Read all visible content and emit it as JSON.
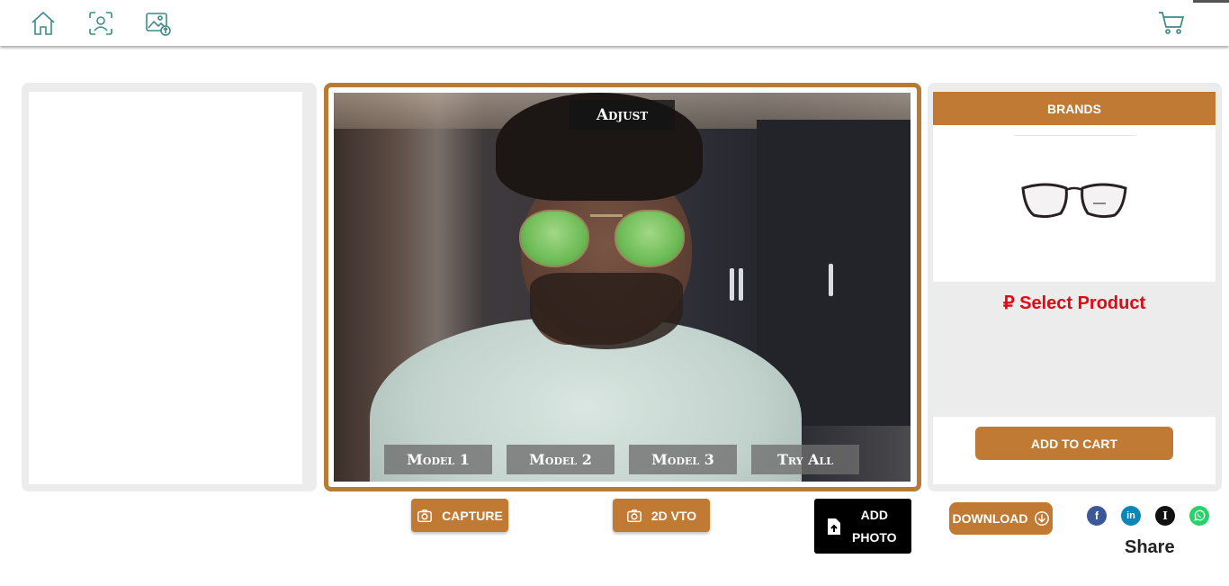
{
  "nav": {
    "icons": [
      "home-icon",
      "face-scan-icon",
      "image-upload-icon"
    ],
    "cart_icon": "cart-icon"
  },
  "viewer": {
    "adjust_label": "Adjust",
    "model_buttons": [
      "Model 1",
      "Model 2",
      "Model 3",
      "Try All"
    ]
  },
  "right_panel": {
    "brands_label": "BRANDS",
    "price_text": "₽ Select Product",
    "add_to_cart_label": "ADD TO CART"
  },
  "actions": {
    "capture_label": "CAPTURE",
    "vto_label": "2D VTO",
    "add_photo_line1": "ADD",
    "add_photo_line2": "PHOTO",
    "download_label": "DOWNLOAD"
  },
  "share": {
    "label": "Share",
    "networks": [
      "f",
      "in",
      "I",
      "whatsapp"
    ]
  },
  "colors": {
    "accent": "#c07a33",
    "price": "#e30613",
    "nav_icon": "#3e8a8a"
  }
}
